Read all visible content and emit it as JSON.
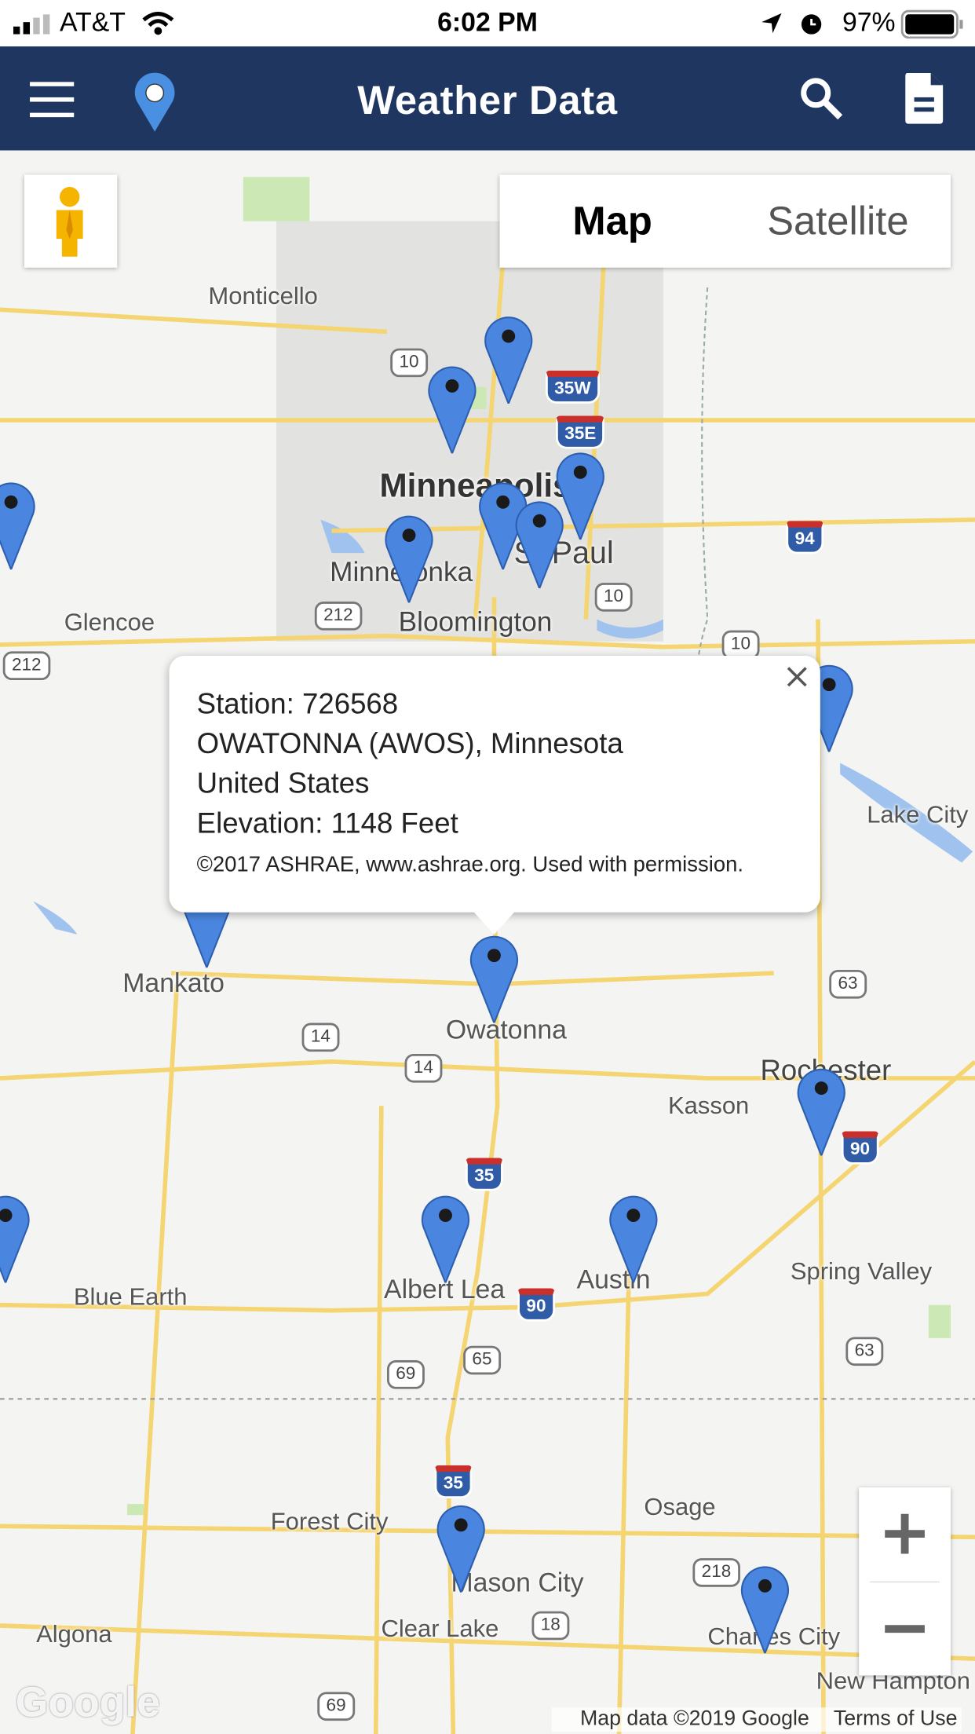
{
  "status_bar": {
    "carrier": "AT&T",
    "time": "6:02 PM",
    "battery": "97%",
    "battery_level_percent": 97
  },
  "header": {
    "title": "Weather Data",
    "icons": [
      "menu-icon",
      "location-pin-icon",
      "search-icon",
      "document-icon"
    ]
  },
  "map_type": {
    "map": "Map",
    "satellite": "Satellite",
    "selected": "Map"
  },
  "map": {
    "labels": [
      "Monticello",
      "Minneapolis",
      "Minnetonka",
      "St Paul",
      "Bloomington",
      "Glencoe",
      "Lake City",
      "Mankato",
      "Owatonna",
      "Rochester",
      "Kasson",
      "Spring Valley",
      "Blue Earth",
      "Albert Lea",
      "Austin",
      "Forest City",
      "Osage",
      "Mason City",
      "Clear Lake",
      "Charles City",
      "Algona",
      "New Hampton"
    ],
    "shields": [
      "10",
      "35W",
      "35E",
      "94",
      "212",
      "10",
      "212",
      "10",
      "63",
      "14",
      "14",
      "35",
      "90",
      "69",
      "65",
      "90",
      "63",
      "35",
      "218",
      "18",
      "69"
    ],
    "marker_color": "#4a86e0"
  },
  "popup": {
    "station": "Station: 726568",
    "name": "OWATONNA (AWOS), Minnesota",
    "country": "United States",
    "elevation": "Elevation: 1148 Feet",
    "copyright": "©2017 ASHRAE, www.ashrae.org. Used with permission."
  },
  "zoom": {
    "in": "+",
    "out": "−"
  },
  "footer": {
    "map_data": "Map data ©2019 Google",
    "terms": "Terms of Use",
    "logo": "Google"
  },
  "colors": {
    "header": "#1e3660",
    "road": "#f5d572",
    "water": "#9fc3ee",
    "park": "#cce8b5"
  }
}
